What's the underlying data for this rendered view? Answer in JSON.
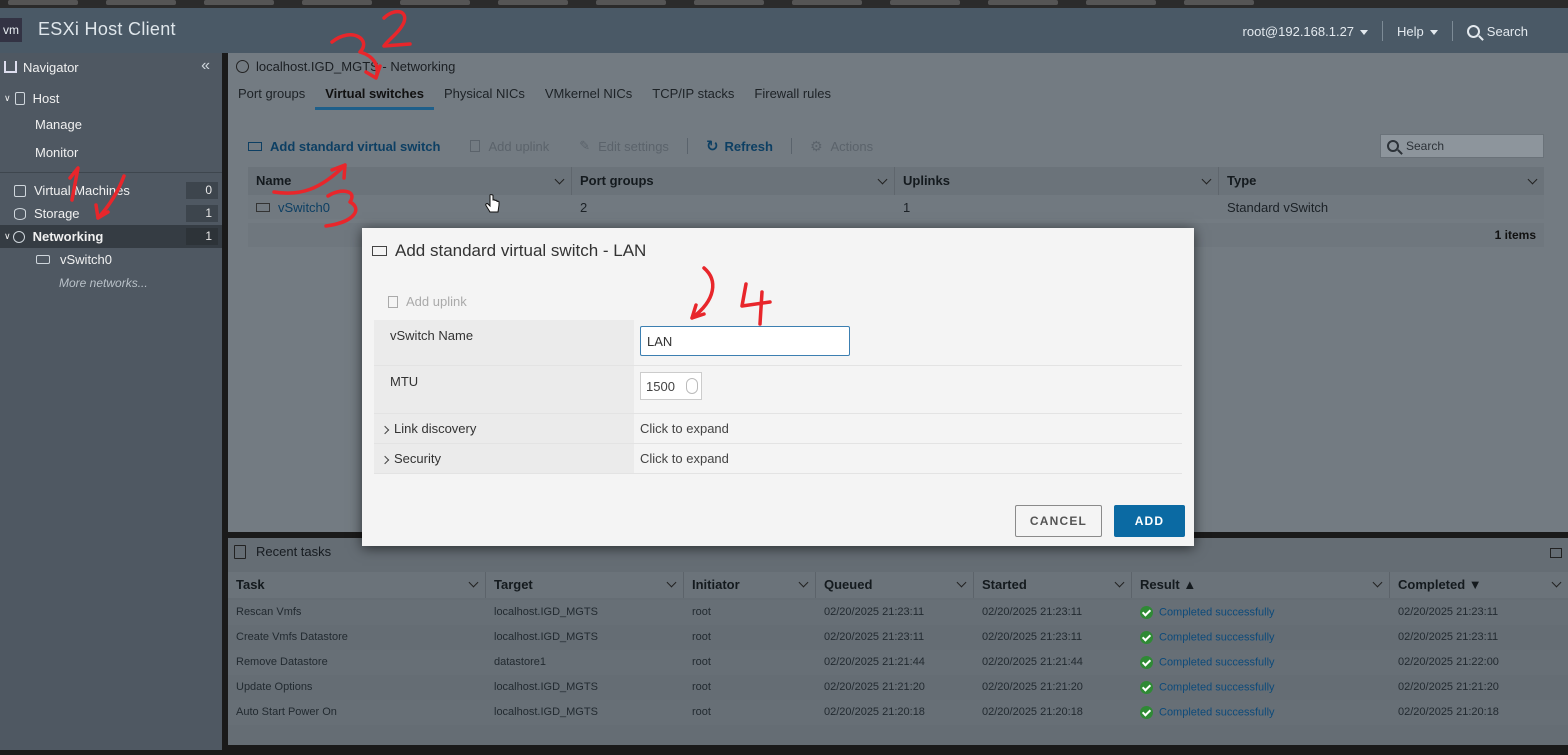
{
  "header": {
    "logo": "vm",
    "title": "ESXi Host Client",
    "user": "root@192.168.1.27",
    "help": "Help",
    "search": "Search"
  },
  "navigator": {
    "title": "Navigator",
    "host": "Host",
    "manage": "Manage",
    "monitor": "Monitor",
    "virtual_machines": "Virtual Machines",
    "virtual_machines_count": "0",
    "storage": "Storage",
    "storage_count": "1",
    "networking": "Networking",
    "networking_count": "1",
    "vswitch0": "vSwitch0",
    "more_networks": "More networks..."
  },
  "main": {
    "title": "localhost.IGD_MGTS - Networking",
    "tabs": [
      "Port groups",
      "Virtual switches",
      "Physical NICs",
      "VMkernel NICs",
      "TCP/IP stacks",
      "Firewall rules"
    ],
    "toolbar": {
      "add_vswitch": "Add standard virtual switch",
      "add_uplink": "Add uplink",
      "edit_settings": "Edit settings",
      "refresh": "Refresh",
      "actions": "Actions",
      "search": "Search"
    },
    "grid": {
      "columns": [
        "Name",
        "Port groups",
        "Uplinks",
        "Type"
      ],
      "row": {
        "name": "vSwitch0",
        "port_groups": "2",
        "uplinks": "1",
        "type": "Standard vSwitch"
      },
      "footer": "1 items"
    }
  },
  "tasks": {
    "title": "Recent tasks",
    "columns": [
      "Task",
      "Target",
      "Initiator",
      "Queued",
      "Started",
      "Result ▲",
      "Completed ▼"
    ],
    "rows": [
      {
        "task": "Rescan Vmfs",
        "target": "localhost.IGD_MGTS",
        "initiator": "root",
        "queued": "02/20/2025 21:23:11",
        "started": "02/20/2025 21:23:11",
        "result": "Completed successfully",
        "completed": "02/20/2025 21:23:11"
      },
      {
        "task": "Create Vmfs Datastore",
        "target": "localhost.IGD_MGTS",
        "initiator": "root",
        "queued": "02/20/2025 21:23:11",
        "started": "02/20/2025 21:23:11",
        "result": "Completed successfully",
        "completed": "02/20/2025 21:23:11"
      },
      {
        "task": "Remove Datastore",
        "target": "datastore1",
        "initiator": "root",
        "queued": "02/20/2025 21:21:44",
        "started": "02/20/2025 21:21:44",
        "result": "Completed successfully",
        "completed": "02/20/2025 21:22:00"
      },
      {
        "task": "Update Options",
        "target": "localhost.IGD_MGTS",
        "initiator": "root",
        "queued": "02/20/2025 21:21:20",
        "started": "02/20/2025 21:21:20",
        "result": "Completed successfully",
        "completed": "02/20/2025 21:21:20"
      },
      {
        "task": "Auto Start Power On",
        "target": "localhost.IGD_MGTS",
        "initiator": "root",
        "queued": "02/20/2025 21:20:18",
        "started": "02/20/2025 21:20:18",
        "result": "Completed successfully",
        "completed": "02/20/2025 21:20:18"
      }
    ]
  },
  "modal": {
    "title": "Add standard virtual switch - LAN",
    "add_uplink": "Add uplink",
    "name_label": "vSwitch Name",
    "name_value": "LAN",
    "mtu_label": "MTU",
    "mtu_value": "1500",
    "link_discovery_label": "Link discovery",
    "link_discovery_value": "Click to expand",
    "security_label": "Security",
    "security_value": "Click to expand",
    "cancel": "CANCEL",
    "add": "ADD"
  },
  "annotations": [
    "1",
    "2",
    "3",
    "4"
  ],
  "colors": {
    "annotation": "#e8262b",
    "primary_button": "#0b6aa3",
    "header_bg": "#4a5966",
    "success": "#2f8a35"
  }
}
